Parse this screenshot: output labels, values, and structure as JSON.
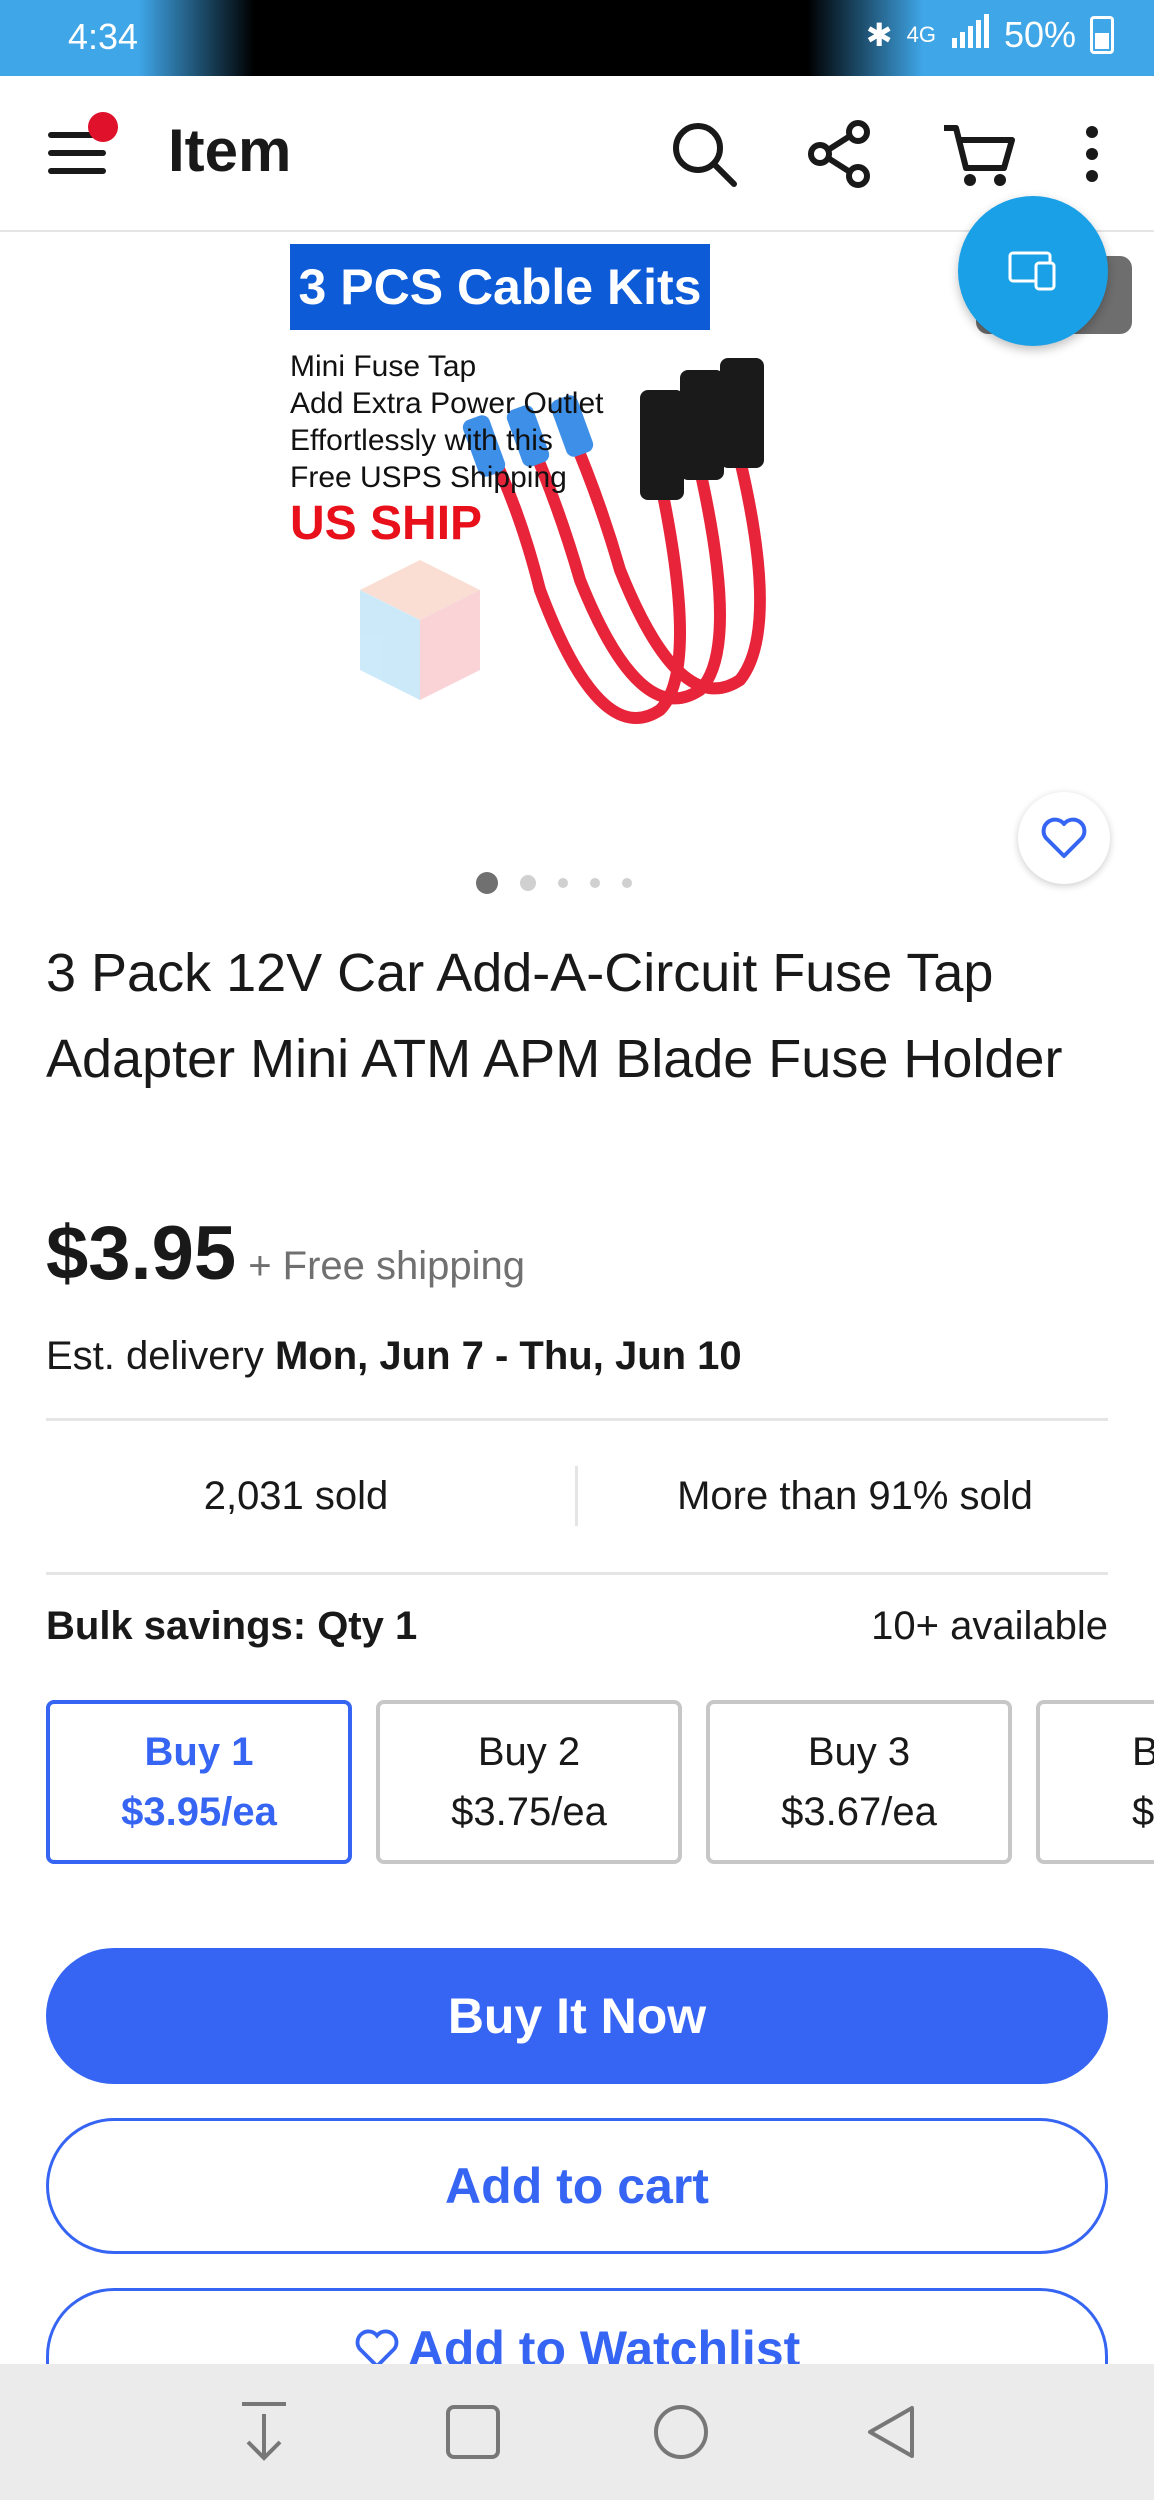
{
  "status_bar": {
    "time": "4:34",
    "network": "4G",
    "battery": "50%"
  },
  "app_bar": {
    "title": "Item"
  },
  "product": {
    "image_banner": "3 PCS Cable Kits",
    "image_lines": [
      "Mini Fuse Tap",
      "Add Extra Power Outlet",
      "Effortlessly with this",
      "Free USPS Shipping"
    ],
    "image_red_text": "US SHIP",
    "title": "3 Pack 12V Car Add-A-Circuit Fuse Tap Adapter Mini ATM APM Blade Fuse Holder",
    "price": "$3.95",
    "shipping": "+ Free shipping",
    "delivery_prefix": "Est. delivery",
    "delivery_dates": "Mon, Jun 7 - Thu, Jun 10"
  },
  "stats": {
    "sold": "2,031 sold",
    "sold_percent": "More than 91% sold"
  },
  "bulk": {
    "label": "Bulk savings: Qty 1",
    "available": "10+ available",
    "options": [
      {
        "label": "Buy 1",
        "price": "$3.95/ea"
      },
      {
        "label": "Buy 2",
        "price": "$3.75/ea"
      },
      {
        "label": "Buy 3",
        "price": "$3.67/ea"
      },
      {
        "label": "B",
        "price": "$3."
      }
    ]
  },
  "actions": {
    "buy_now": "Buy It Now",
    "add_to_cart": "Add to cart",
    "watchlist": "Add to Watchlist"
  },
  "image_carousel": {
    "count": 5,
    "active_index": 0
  },
  "colors": {
    "accent": "#3665f3",
    "notification_dot": "#e0112b",
    "cast_fab": "#1aa0e6"
  }
}
